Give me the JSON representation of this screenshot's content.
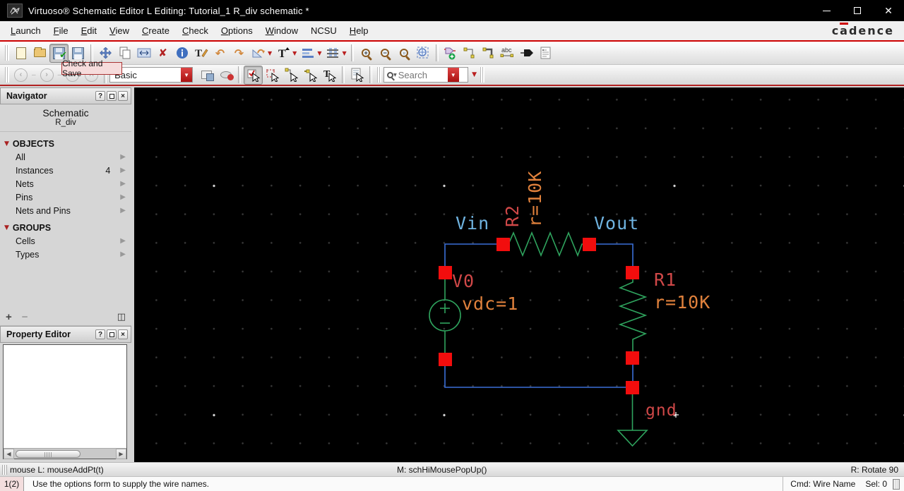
{
  "window": {
    "title": "Virtuoso® Schematic Editor L Editing: Tutorial_1 R_div schematic *"
  },
  "menubar": {
    "items": [
      {
        "label": "Launch"
      },
      {
        "label": "File"
      },
      {
        "label": "Edit"
      },
      {
        "label": "View"
      },
      {
        "label": "Create"
      },
      {
        "label": "Check"
      },
      {
        "label": "Options"
      },
      {
        "label": "Window"
      },
      {
        "label": "NCSU"
      },
      {
        "label": "Help"
      }
    ],
    "logo": {
      "c": "c",
      "a": "a",
      "rest": "dence"
    }
  },
  "toolbar": {
    "tooltip": "Check and Save",
    "workspace": "Basic",
    "search_placeholder": "Search",
    "row1_icons": [
      "new-file",
      "open",
      "check-and-save",
      "save",
      "move",
      "copy",
      "stretch",
      "delete",
      "object-properties",
      "edit-labels",
      "undo",
      "redo",
      "rotate",
      "add-text",
      "align",
      "distribute",
      "zoom-in",
      "zoom-out",
      "zoom-to-fit",
      "zoom-to-selected",
      "create-instance",
      "create-wire",
      "create-wide-wire",
      "create-wire-name",
      "create-pin",
      "create-note"
    ],
    "row2_icons": [
      "nav-back",
      "nav-forward",
      "nav-down",
      "nav-up",
      "workspace-combo",
      "save-workspace",
      "toggle-visibility",
      "select-full",
      "select-partial",
      "select-net",
      "select-pin",
      "select-label",
      "options-form",
      "search"
    ]
  },
  "navigator": {
    "title": "Navigator",
    "view": "Schematic",
    "cell": "R_div",
    "objects_header": "OBJECTS",
    "objects": [
      {
        "label": "All"
      },
      {
        "label": "Instances",
        "count": "4"
      },
      {
        "label": "Nets"
      },
      {
        "label": "Pins"
      },
      {
        "label": "Nets and Pins"
      }
    ],
    "groups_header": "GROUPS",
    "groups": [
      {
        "label": "Cells"
      },
      {
        "label": "Types"
      }
    ]
  },
  "property_editor": {
    "title": "Property Editor"
  },
  "schematic": {
    "nets": [
      {
        "name": "Vin"
      },
      {
        "name": "Vout"
      }
    ],
    "instances": [
      {
        "name": "V0",
        "value": "vdc=1"
      },
      {
        "name": "R2",
        "value": "r=10K"
      },
      {
        "name": "R1",
        "value": "r=10K"
      },
      {
        "name": "gnd"
      }
    ],
    "colors": {
      "wire": "#3a6fd7",
      "component": "#2fa45e",
      "pin_square": "#f20d0d",
      "instance_label": "#d04848",
      "param_label": "#e0813c",
      "net_label": "#6fb3e0"
    }
  },
  "statusbar": {
    "left": "mouse L: mouseAddPt(t)",
    "middle": "M: schHiMousePopUp()",
    "right": "R: Rotate 90"
  },
  "cmdbar": {
    "badge": "1(2)",
    "message": "Use the options form to supply the wire names.",
    "cmd": "Cmd: Wire Name",
    "sel": "Sel: 0"
  }
}
